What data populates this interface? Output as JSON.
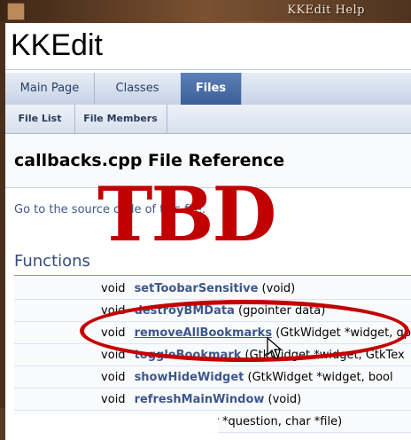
{
  "window": {
    "title": "KKEdit Help"
  },
  "project": {
    "name": "KKEdit"
  },
  "tabs": [
    {
      "label": "Main Page"
    },
    {
      "label": "Classes"
    },
    {
      "label": "Files",
      "active": true
    }
  ],
  "subtabs": [
    {
      "label": "File List"
    },
    {
      "label": "File Members"
    }
  ],
  "page": {
    "title": "callbacks.cpp File Reference",
    "source_link": "Go to the source code of this file."
  },
  "functions": {
    "heading": "Functions",
    "rows": [
      {
        "ret": "void",
        "name": "setToobarSensitive",
        "args": " (void)"
      },
      {
        "ret": "void",
        "name": "destroyBMData",
        "args": " (gpointer data)"
      },
      {
        "ret": "void",
        "name": "removeAllBookmarks",
        "args": " (GtkWidget *widget, gp"
      },
      {
        "ret": "void",
        "name": "toggleBookmark",
        "args": " (GtkWidget *widget, GtkTex"
      },
      {
        "ret": "void",
        "name": "showHideWidget",
        "args": " (GtkWidget *widget, bool"
      },
      {
        "ret": "void",
        "name": "refreshMainWindow",
        "args": " (void)"
      },
      {
        "ret": "",
        "name": "",
        "args": "r *question, char *file)"
      }
    ]
  },
  "overlay": {
    "stamp_text": "TBD",
    "stamp_color": "#c10000"
  },
  "icons": {
    "cursor": "pointer-cursor-icon",
    "window": "app-window-icon"
  }
}
